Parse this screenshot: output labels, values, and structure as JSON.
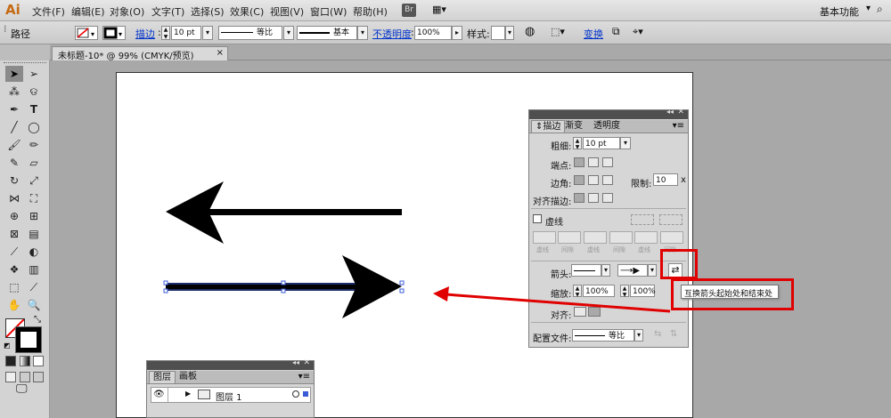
{
  "app": {
    "logo": "Ai",
    "menus": [
      "文件(F)",
      "编辑(E)",
      "对象(O)",
      "文字(T)",
      "选择(S)",
      "效果(C)",
      "视图(V)",
      "窗口(W)",
      "帮助(H)"
    ],
    "br_badge": "Br",
    "workspace": "基本功能"
  },
  "options": {
    "selection_type": "路径",
    "stroke_link": "描边",
    "stroke_weight": "10 pt",
    "profile_label": "等比",
    "brush_label": "基本",
    "opacity_link": "不透明度",
    "opacity_value": "100%",
    "style_label": "样式:",
    "transform_link": "变换"
  },
  "document": {
    "tab_title": "未标题-10* @ 99% (CMYK/预览)"
  },
  "stroke_panel": {
    "tabs": [
      "描边",
      "渐变",
      "透明度"
    ],
    "weight_label": "粗细:",
    "weight_value": "10 pt",
    "cap_label": "端点:",
    "corner_label": "边角:",
    "limit_label": "限制:",
    "limit_value": "10",
    "limit_unit": "x",
    "align_label": "对齐描边:",
    "dashed_label": "虚线",
    "dash_cells": [
      "虚线",
      "间隙",
      "虚线",
      "间隙",
      "虚线",
      "间隙"
    ],
    "arrow_label": "箭头:",
    "scale_label": "缩放:",
    "scale_start": "100%",
    "scale_end": "100%",
    "align_arrow_label": "对齐:",
    "profile_label": "配置文件:",
    "profile_value": "等比"
  },
  "tooltip": {
    "text": "互换箭头起始处和结束处"
  },
  "layers_panel": {
    "tabs": [
      "图层",
      "画板"
    ],
    "layer_name": "图层 1"
  },
  "colors": {
    "accent_red": "#e00000",
    "link_blue": "#0033cc"
  }
}
